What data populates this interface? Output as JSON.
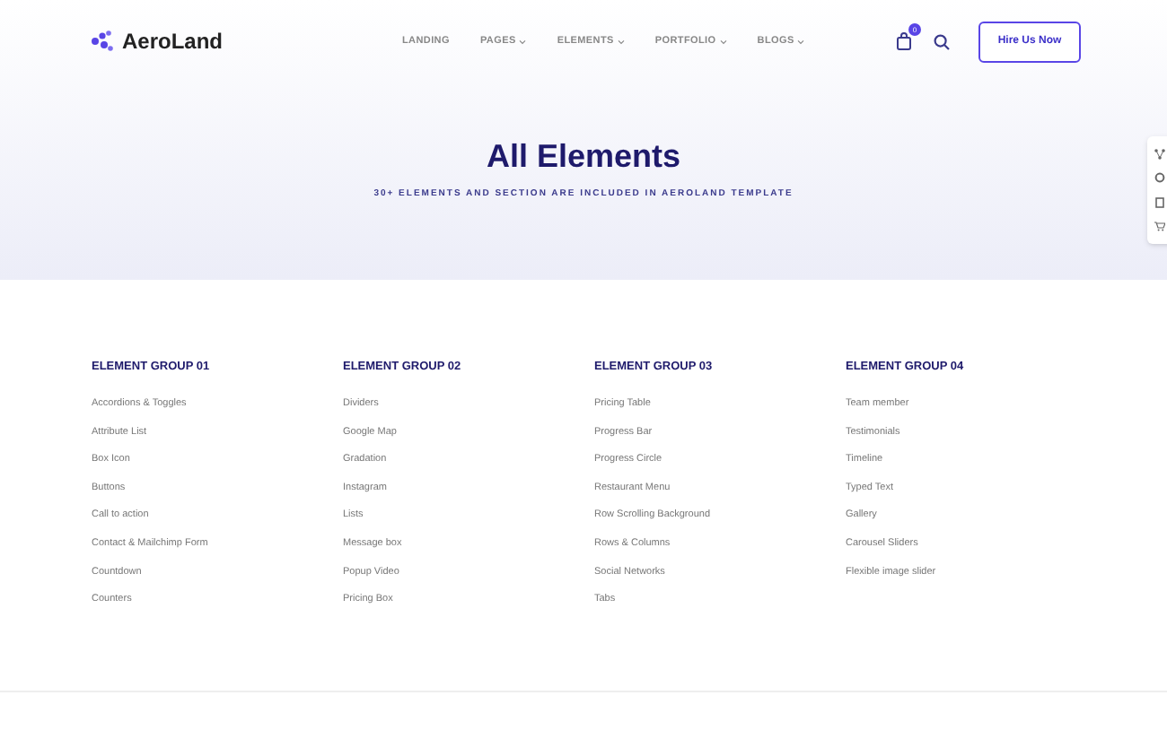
{
  "logo": {
    "text": "AeroLand"
  },
  "nav": [
    {
      "label": "LANDING",
      "dropdown": false
    },
    {
      "label": "PAGES",
      "dropdown": true
    },
    {
      "label": "ELEMENTS",
      "dropdown": true
    },
    {
      "label": "PORTFOLIO",
      "dropdown": true
    },
    {
      "label": "BLOGS",
      "dropdown": true
    }
  ],
  "cart": {
    "count": "0"
  },
  "cta": "Hire Us Now",
  "hero": {
    "title": "All Elements",
    "subtitle": "30+ ELEMENTS AND SECTION ARE INCLUDED IN AEROLAND TEMPLATE"
  },
  "groups": [
    {
      "title": "ELEMENT GROUP 01",
      "items": [
        "Accordions & Toggles",
        "Attribute List",
        "Box Icon",
        "Buttons",
        "Call to action",
        "Contact & Mailchimp Form",
        "Countdown",
        "Counters"
      ]
    },
    {
      "title": "ELEMENT GROUP 02",
      "items": [
        "Dividers",
        "Google Map",
        "Gradation",
        "Instagram",
        "Lists",
        "Message box",
        "Popup Video",
        "Pricing Box"
      ]
    },
    {
      "title": "ELEMENT GROUP 03",
      "items": [
        "Pricing Table",
        "Progress Bar",
        "Progress Circle",
        "Restaurant Menu",
        "Row Scrolling Background",
        "Rows & Columns",
        "Social Networks",
        "Tabs"
      ]
    },
    {
      "title": "ELEMENT GROUP 04",
      "items": [
        "Team member",
        "Testimonials",
        "Timeline",
        "Typed Text",
        "Gallery",
        "Carousel Sliders",
        "Flexible image slider"
      ]
    }
  ]
}
